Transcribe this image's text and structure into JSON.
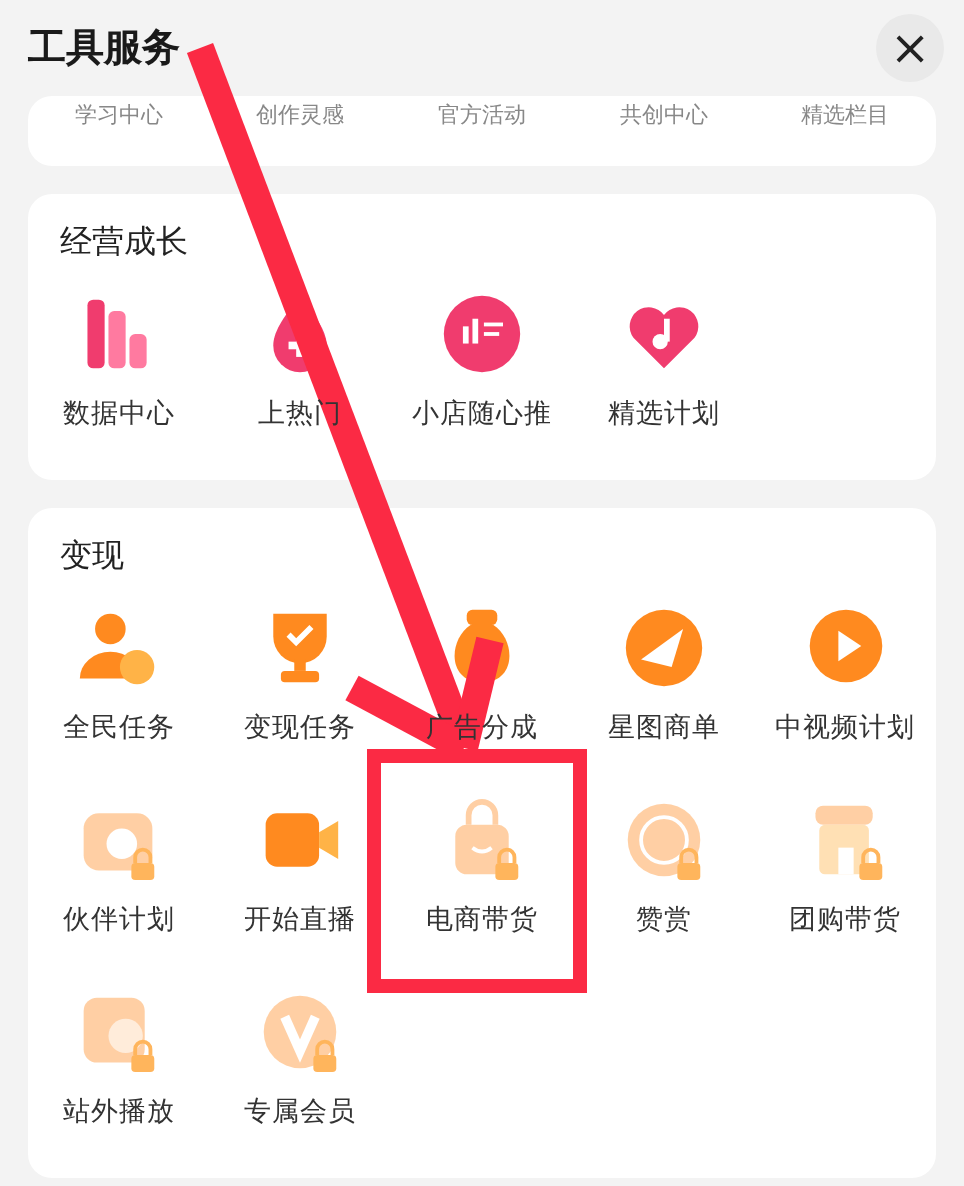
{
  "header": {
    "title": "工具服务",
    "close": "×"
  },
  "top_strip": {
    "items": [
      "学习中心",
      "创作灵感",
      "官方活动",
      "共创中心",
      "精选栏目"
    ]
  },
  "sections": [
    {
      "title": "经营成长",
      "items": [
        {
          "label": "数据中心",
          "locked": false
        },
        {
          "label": "上热门",
          "locked": false
        },
        {
          "label": "小店随心推",
          "locked": false
        },
        {
          "label": "精选计划",
          "locked": false
        }
      ]
    },
    {
      "title": "变现",
      "items": [
        {
          "label": "全民任务",
          "locked": false
        },
        {
          "label": "变现任务",
          "locked": false
        },
        {
          "label": "广告分成",
          "locked": false
        },
        {
          "label": "星图商单",
          "locked": false
        },
        {
          "label": "中视频计划",
          "locked": false
        },
        {
          "label": "伙伴计划",
          "locked": true
        },
        {
          "label": "开始直播",
          "locked": false
        },
        {
          "label": "电商带货",
          "locked": true
        },
        {
          "label": "赞赏",
          "locked": true
        },
        {
          "label": "团购带货",
          "locked": true
        },
        {
          "label": "站外播放",
          "locked": true
        },
        {
          "label": "专属会员",
          "locked": true
        }
      ]
    }
  ]
}
